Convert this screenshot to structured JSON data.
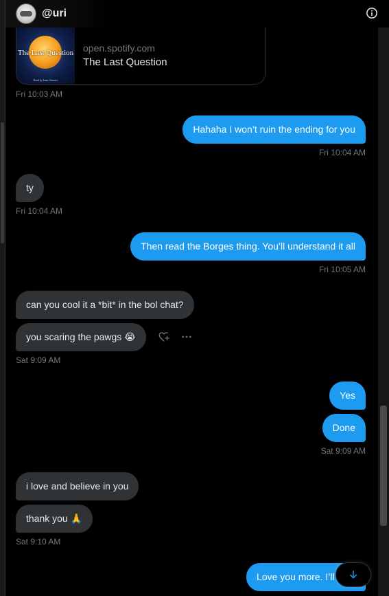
{
  "header": {
    "handle": "@uri",
    "avatar_icon": "avatar-icon",
    "info_icon": "info-icon"
  },
  "link_card": {
    "domain": "open.spotify.com",
    "title": "The Last Question",
    "cover_title": "The Last Question",
    "cover_credit": "Read by Isaac Asimov"
  },
  "messages": [
    {
      "id": "m1",
      "direction": "in",
      "text": "",
      "timestamp": "Fri 10:03 AM"
    },
    {
      "id": "m2",
      "direction": "out",
      "text": "Hahaha I won’t ruin the ending for you",
      "timestamp": "Fri 10:04 AM"
    },
    {
      "id": "m3",
      "direction": "in",
      "text": "ty",
      "timestamp": "Fri 10:04 AM"
    },
    {
      "id": "m4",
      "direction": "out",
      "text": "Then read the Borges thing. You’ll understand it all",
      "timestamp": "Fri 10:05 AM"
    },
    {
      "id": "m5",
      "direction": "in",
      "text": "can you cool it a *bit* in the bol chat?",
      "timestamp": ""
    },
    {
      "id": "m6",
      "direction": "in",
      "text": "you scaring the pawgs 😭",
      "timestamp": "Sat 9:09 AM"
    },
    {
      "id": "m7",
      "direction": "out",
      "text": "Yes",
      "timestamp": ""
    },
    {
      "id": "m8",
      "direction": "out",
      "text": "Done",
      "timestamp": "Sat 9:09 AM"
    },
    {
      "id": "m9",
      "direction": "in",
      "text": "i love and believe in you",
      "timestamp": ""
    },
    {
      "id": "m10",
      "direction": "in",
      "text": "thank you 🙏",
      "timestamp": "Sat 9:10 AM"
    },
    {
      "id": "m11",
      "direction": "out",
      "text": "Love you more. I’ll post",
      "timestamp": ""
    }
  ],
  "icons": {
    "react": "heart-plus-icon",
    "more": "more-horizontal-icon",
    "scroll_down": "arrow-down-icon"
  },
  "colors": {
    "background": "#000000",
    "outgoing_bubble": "#1d9bf0",
    "incoming_bubble": "#2f3336",
    "timestamp": "#71767b",
    "text": "#e7e9ea"
  }
}
